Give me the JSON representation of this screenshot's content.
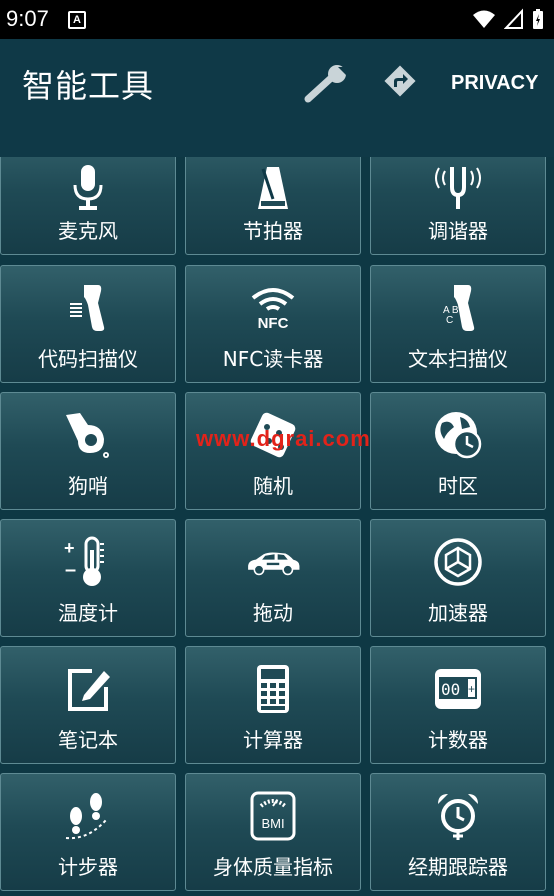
{
  "status_bar": {
    "time": "9:07",
    "notification_letter": "A"
  },
  "app_bar": {
    "title": "智能工具",
    "privacy_label": "PRIVACY"
  },
  "tools": [
    {
      "label": "麦克风",
      "icon": "microphone-icon"
    },
    {
      "label": "节拍器",
      "icon": "metronome-icon"
    },
    {
      "label": "调谐器",
      "icon": "tuning-fork-icon"
    },
    {
      "label": "代码扫描仪",
      "icon": "barcode-scanner-icon"
    },
    {
      "label": "NFC读卡器",
      "icon": "nfc-icon"
    },
    {
      "label": "文本扫描仪",
      "icon": "text-scanner-icon"
    },
    {
      "label": "狗哨",
      "icon": "whistle-icon"
    },
    {
      "label": "随机",
      "icon": "dice-icon"
    },
    {
      "label": "时区",
      "icon": "globe-clock-icon"
    },
    {
      "label": "温度计",
      "icon": "thermometer-icon"
    },
    {
      "label": "拖动",
      "icon": "car-icon"
    },
    {
      "label": "加速器",
      "icon": "accelerometer-icon"
    },
    {
      "label": "笔记本",
      "icon": "notepad-icon"
    },
    {
      "label": "计算器",
      "icon": "calculator-icon"
    },
    {
      "label": "计数器",
      "icon": "counter-icon"
    },
    {
      "label": "计步器",
      "icon": "footsteps-icon"
    },
    {
      "label": "身体质量指标",
      "icon": "bmi-scale-icon"
    },
    {
      "label": "经期跟踪器",
      "icon": "alarm-clock-icon"
    }
  ],
  "counter_display": "00",
  "bmi_text": "BMI",
  "nfc_text": "NFC",
  "watermark": "www.dgrai.com",
  "colors": {
    "background": "#0e3844",
    "tile_top": "#32606a",
    "tile_bottom": "#163c47",
    "watermark": "#e2231a"
  }
}
